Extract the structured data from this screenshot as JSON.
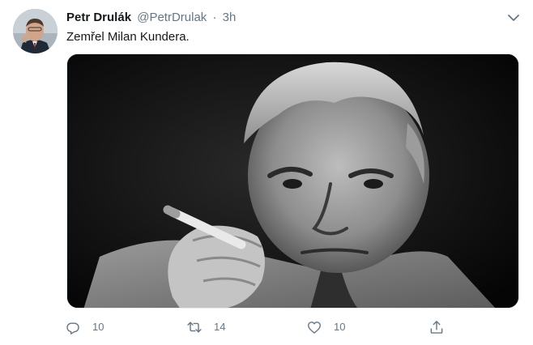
{
  "tweet": {
    "author": {
      "display_name": "Petr Drulák",
      "handle": "@PetrDrulak"
    },
    "separator": "·",
    "time": "3h",
    "text": "Zemřel Milan Kundera.",
    "media": {
      "type": "photo",
      "style": "black-and-white portrait"
    },
    "actions": {
      "reply_count": "10",
      "retweet_count": "14",
      "like_count": "10"
    }
  },
  "colors": {
    "text_primary": "#14171a",
    "text_secondary": "#657786",
    "background": "#ffffff"
  },
  "icons": [
    "chevron-down-icon",
    "reply-icon",
    "retweet-icon",
    "like-icon",
    "share-icon"
  ]
}
